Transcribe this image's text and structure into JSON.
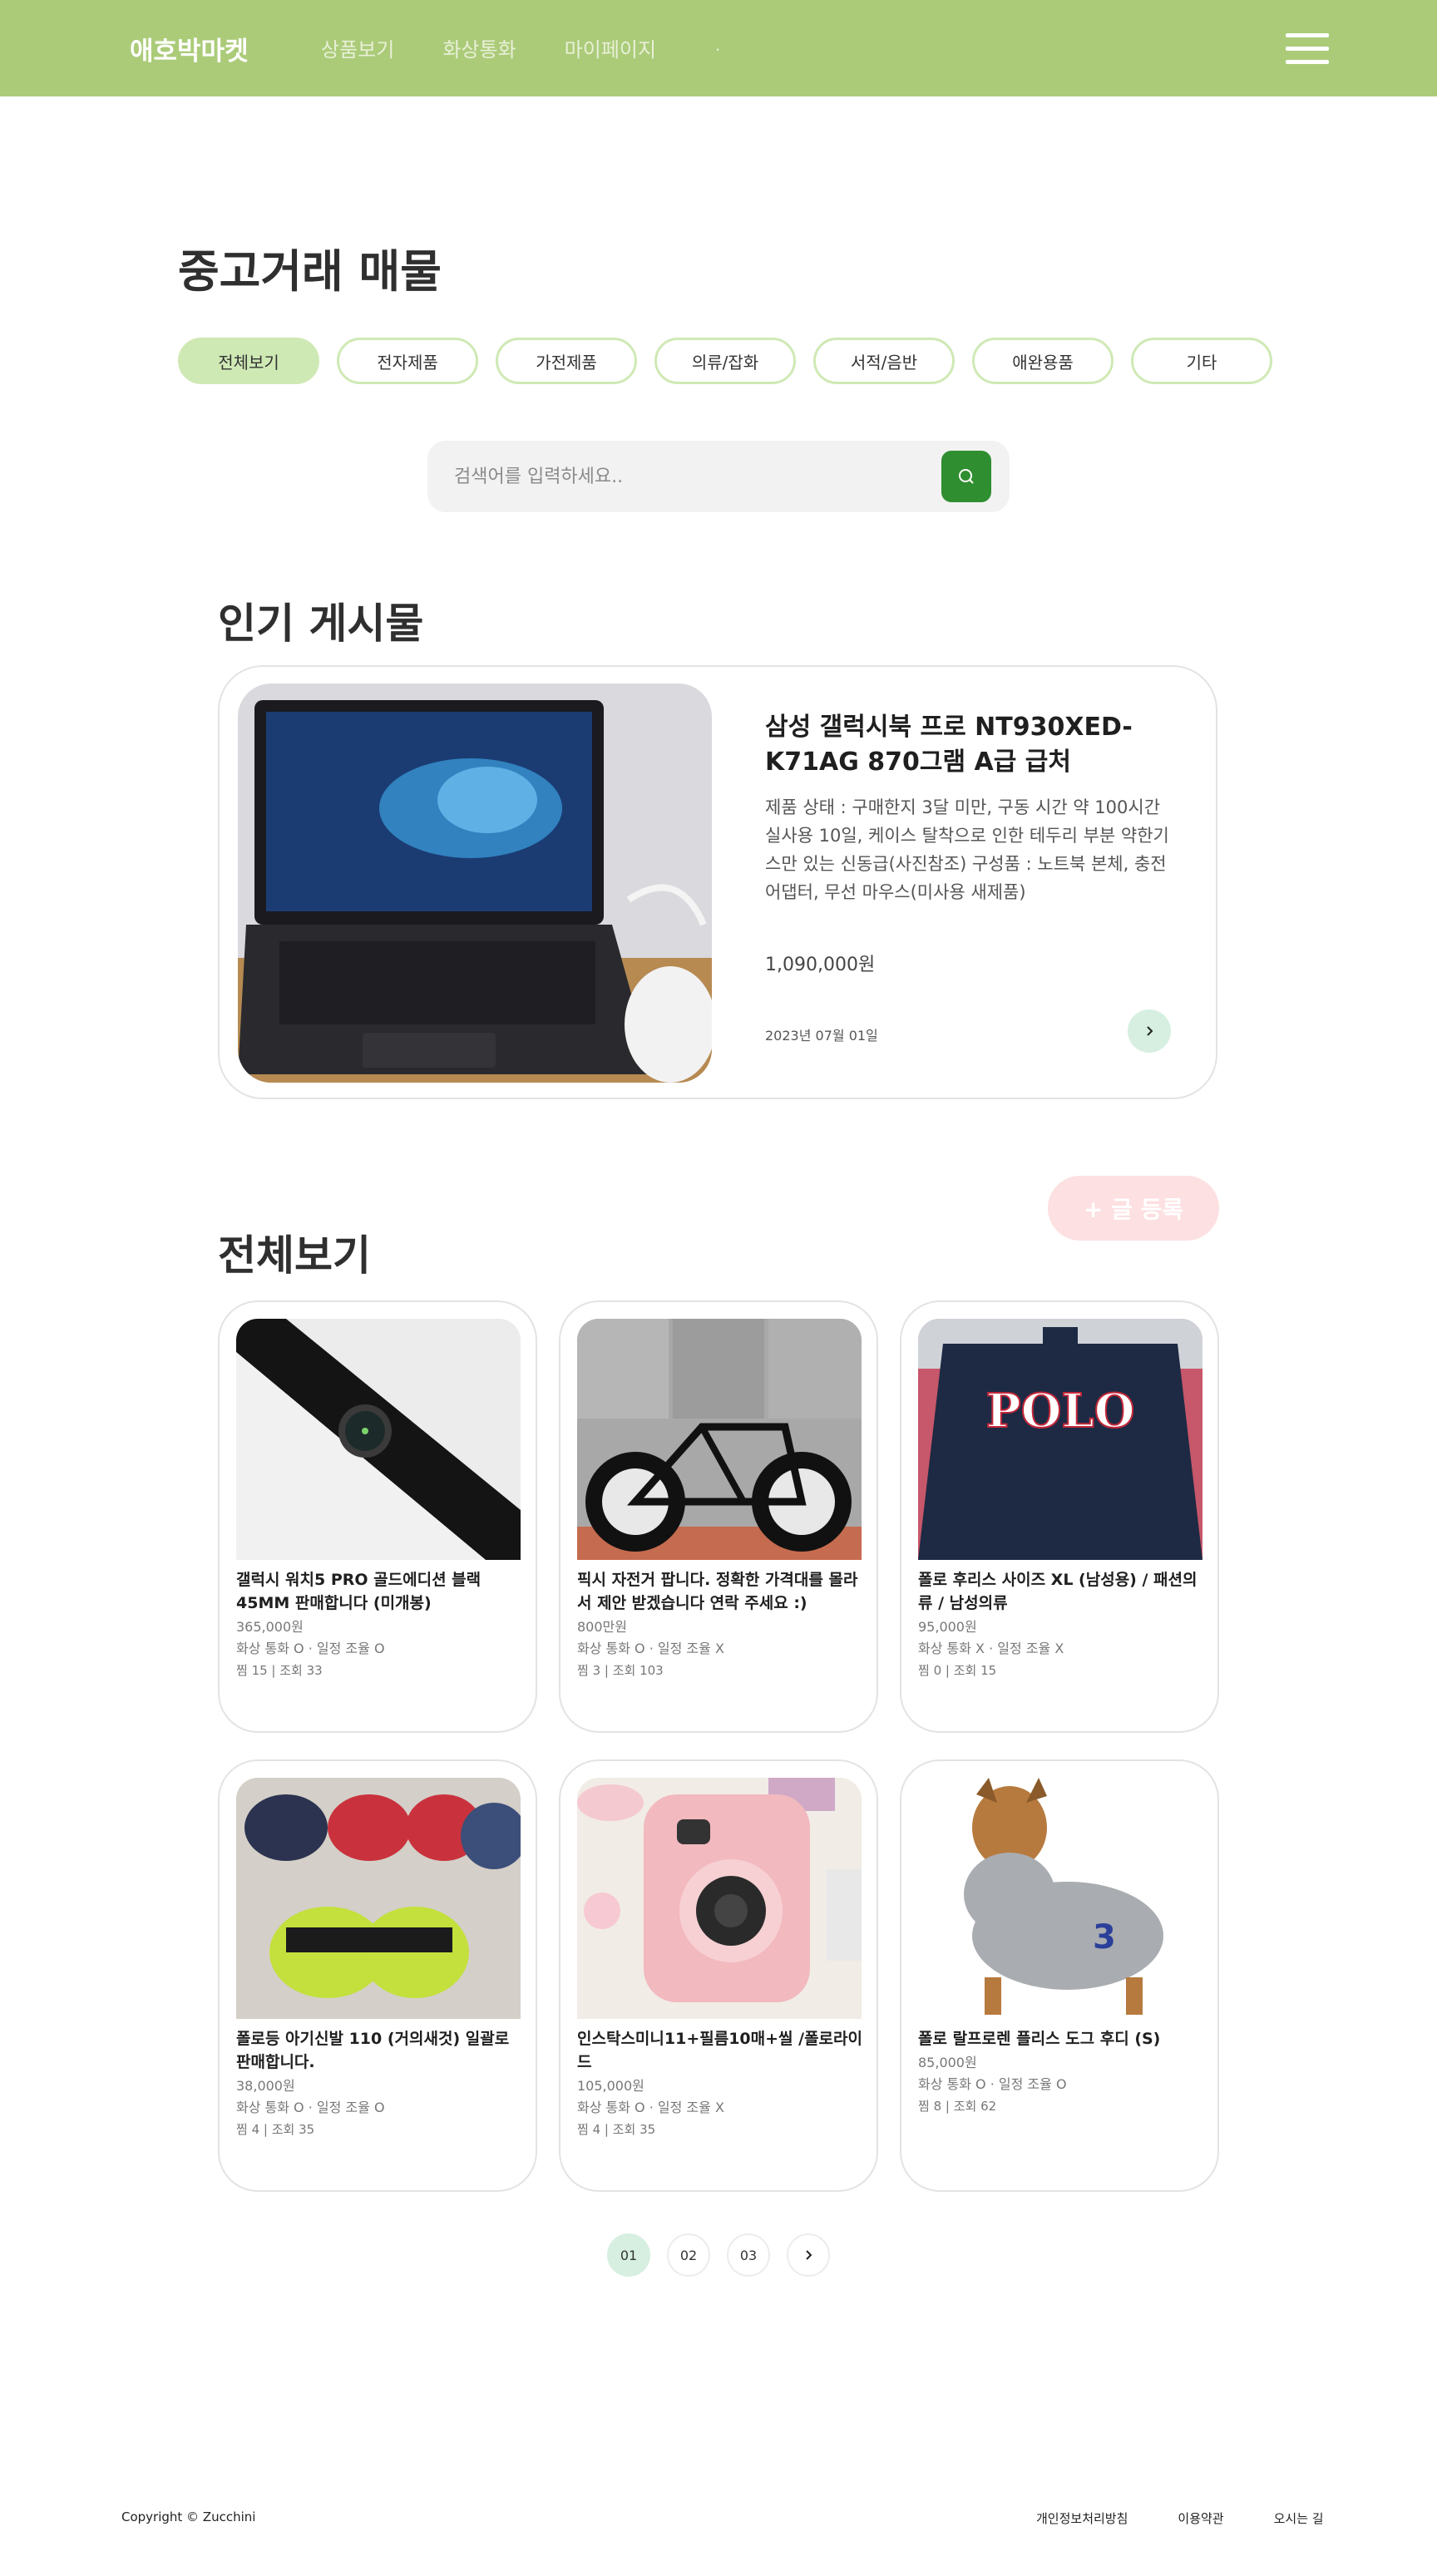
{
  "header": {
    "logo": "애호박마켓",
    "nav": [
      "상품보기",
      "화상통화",
      "마이페이지"
    ],
    "nav_extra": "."
  },
  "page_title": "중고거래 매물",
  "filters": [
    "전체보기",
    "전자제품",
    "가전제품",
    "의류/잡화",
    "서적/음반",
    "애완용품",
    "기타"
  ],
  "active_filter": "전체보기",
  "search": {
    "placeholder": "검색어를 입력하세요.."
  },
  "popular": {
    "section_title": "인기 게시물",
    "title": "삼성 갤럭시북 프로 NT930XED-K71AG 870그램 A급 급처",
    "description": "제품 상태 : 구매한지 3달 미만, 구동 시간 약 100시간 실사용 10일, 케이스 탈착으로 인한 테두리 부분 약한기스만 있는 신동급(사진참조) 구성품 : 노트북 본체, 충전 어댑터, 무선 마우스(미사용 새제품)",
    "price": "1,090,000원",
    "date": "2023년 07월 01일"
  },
  "write_button": "+ 글 등록",
  "all_section_title": "전체보기",
  "items": [
    {
      "title": "갤럭시 워치5 PRO 골드에디션 블랙 45MM 판매합니다 (미개봉)",
      "price": "365,000원",
      "options": "화상 통화 O  ·  일정 조율 O",
      "stats": "찜 15  |  조회 33"
    },
    {
      "title": "픽시 자전거 팝니다. 정확한 가격대를 몰라서 제안 받겠습니다 연락 주세요 :)",
      "price": "800만원",
      "options": "화상 통화 O  ·  일정 조율 X",
      "stats": "찜 3  |  조회 103"
    },
    {
      "title": "폴로 후리스 사이즈 XL (남성용) / 패션의류 / 남성의류",
      "price": "95,000원",
      "options": "화상 통화 X  ·  일정 조율 X",
      "stats": "찜 0  |  조회 15"
    },
    {
      "title": "폴로등 아기신발 110 (거의새것) 일괄로 판매합니다.",
      "price": "38,000원",
      "options": "화상 통화 O  ·  일정 조율 O",
      "stats": "찜 4  |  조회 35"
    },
    {
      "title": "인스탁스미니11+필름10매+씰 /폴로라이드",
      "price": "105,000원",
      "options": "화상 통화 O  ·  일정 조율 X",
      "stats": "찜 4  |  조회 35"
    },
    {
      "title": "폴로 랄프로렌 플리스 도그 후디 (S)",
      "price": "85,000원",
      "options": "화상 통화 O  ·  일정 조율 O",
      "stats": "찜 8  |  조회 62"
    }
  ],
  "pagination": [
    "01",
    "02",
    "03"
  ],
  "footer": {
    "copyright": "Copyright © Zucchini",
    "links": [
      "개인정보처리방침",
      "이용약관",
      "오시는 길"
    ]
  },
  "colors": {
    "header": "#abcb79",
    "chip_active": "#cfe9b5",
    "search_button": "#2f8e2f",
    "write_button": "#fde0e1",
    "arrow_bg": "#d6efe0"
  }
}
